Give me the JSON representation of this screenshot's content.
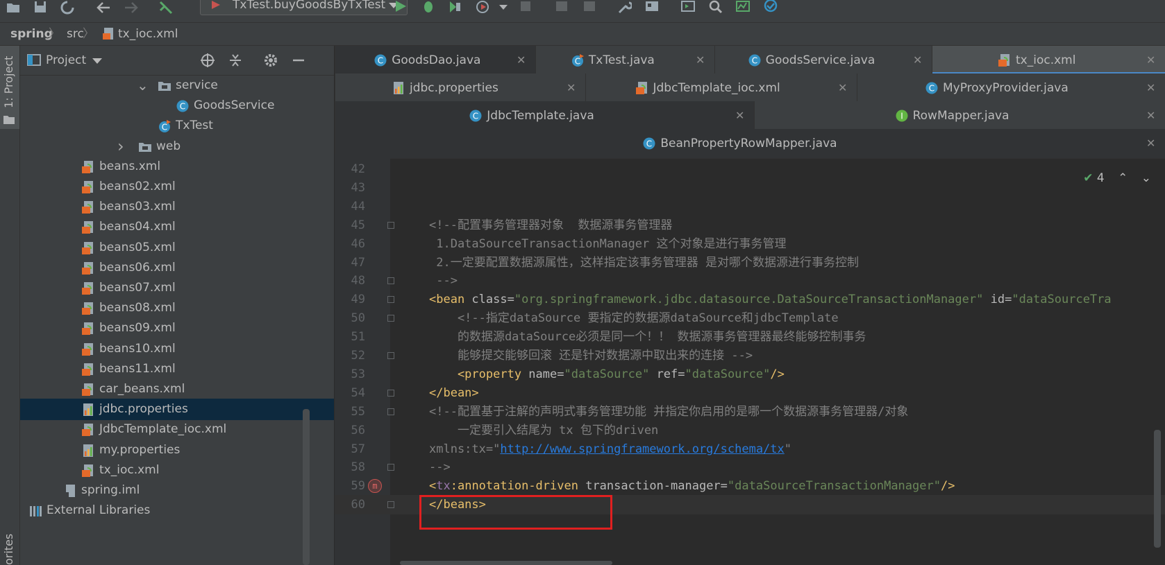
{
  "toolbar": {
    "run_config": "TxTest.buyGoodsByTxTest",
    "icons": [
      "open-icon",
      "save-icon",
      "sync-icon",
      "back-icon",
      "forward-icon",
      "build-icon",
      "run-icon",
      "debug-icon",
      "coverage-icon",
      "profile-icon",
      "stop-icon",
      "attach-icon",
      "layout-icon",
      "settings-icon",
      "structure-icon",
      "terminal-icon",
      "search-icon",
      "metrics-icon",
      "check-icon"
    ]
  },
  "navbar": {
    "crumbs": [
      "spring",
      "src",
      "tx_ioc.xml"
    ]
  },
  "stripe": {
    "project_label": "1: Project",
    "favorites_label": "orites"
  },
  "project_panel": {
    "title": "Project",
    "tree": [
      {
        "label": "service",
        "type": "folder",
        "depth": 3,
        "expanded": true
      },
      {
        "label": "GoodsService",
        "type": "class",
        "depth": 4
      },
      {
        "label": "TxTest",
        "type": "class-test",
        "depth": 3
      },
      {
        "label": "web",
        "type": "folder",
        "depth": 2,
        "expanded": false
      },
      {
        "label": "beans.xml",
        "type": "xml",
        "depth": 1
      },
      {
        "label": "beans02.xml",
        "type": "xml",
        "depth": 1
      },
      {
        "label": "beans03.xml",
        "type": "xml",
        "depth": 1
      },
      {
        "label": "beans04.xml",
        "type": "xml",
        "depth": 1
      },
      {
        "label": "beans05.xml",
        "type": "xml",
        "depth": 1
      },
      {
        "label": "beans06.xml",
        "type": "xml",
        "depth": 1
      },
      {
        "label": "beans07.xml",
        "type": "xml",
        "depth": 1
      },
      {
        "label": "beans08.xml",
        "type": "xml",
        "depth": 1
      },
      {
        "label": "beans09.xml",
        "type": "xml",
        "depth": 1
      },
      {
        "label": "beans10.xml",
        "type": "xml",
        "depth": 1
      },
      {
        "label": "beans11.xml",
        "type": "xml",
        "depth": 1
      },
      {
        "label": "car_beans.xml",
        "type": "xml",
        "depth": 1
      },
      {
        "label": "jdbc.properties",
        "type": "properties",
        "depth": 1,
        "selected": true
      },
      {
        "label": "JdbcTemplate_ioc.xml",
        "type": "xml",
        "depth": 1
      },
      {
        "label": "my.properties",
        "type": "properties",
        "depth": 1
      },
      {
        "label": "tx_ioc.xml",
        "type": "xml",
        "depth": 1
      },
      {
        "label": "spring.iml",
        "type": "iml",
        "depth": 0
      },
      {
        "label": "External Libraries",
        "type": "libs",
        "depth": -1,
        "expanded": false
      }
    ]
  },
  "tabs": {
    "row1": [
      {
        "label": "GoodsDao.java",
        "icon": "class-icon"
      },
      {
        "label": "TxTest.java",
        "icon": "test-class-icon"
      },
      {
        "label": "GoodsService.java",
        "icon": "class-icon"
      },
      {
        "label": "tx_ioc.xml",
        "icon": "xml-icon",
        "active": true
      }
    ],
    "row2": [
      {
        "label": "jdbc.properties",
        "icon": "properties-icon"
      },
      {
        "label": "JdbcTemplate_ioc.xml",
        "icon": "xml-icon"
      },
      {
        "label": "MyProxyProvider.java",
        "icon": "class-icon"
      }
    ],
    "row3": [
      {
        "label": "JdbcTemplate.java",
        "icon": "class-icon"
      },
      {
        "label": "RowMapper.java",
        "icon": "interface-icon"
      }
    ],
    "row4": [
      {
        "label": "BeanPropertyRowMapper.java",
        "icon": "class-icon"
      }
    ],
    "close_glyph": "✕"
  },
  "editor": {
    "inspection_count": "4",
    "lines": [
      {
        "n": "42",
        "segments": []
      },
      {
        "n": "43",
        "segments": []
      },
      {
        "n": "44",
        "segments": []
      },
      {
        "n": "45",
        "segments": [
          {
            "t": "<!--配置事务管理器对象  数据源事务管理器",
            "c": "c-comment"
          }
        ]
      },
      {
        "n": "46",
        "segments": [
          {
            "t": " 1.DataSourceTransactionManager 这个对象是进行事务管理",
            "c": "c-comment"
          }
        ]
      },
      {
        "n": "47",
        "segments": [
          {
            "t": " 2.一定要配置数据源属性，这样指定该事务管理器 是对哪个数据源进行事务控制",
            "c": "c-comment"
          }
        ]
      },
      {
        "n": "48",
        "segments": [
          {
            "t": " -->",
            "c": "c-comment"
          }
        ]
      },
      {
        "n": "49",
        "segments": [
          {
            "t": "<bean ",
            "c": "c-tag"
          },
          {
            "t": "class",
            "c": "c-attr"
          },
          {
            "t": "=",
            "c": "c-attr"
          },
          {
            "t": "\"org.springframework.jdbc.datasource.DataSourceTransactionManager\"",
            "c": "c-val"
          },
          {
            "t": " id",
            "c": "c-attr"
          },
          {
            "t": "=",
            "c": "c-attr"
          },
          {
            "t": "\"dataSourceTra",
            "c": "c-val"
          }
        ]
      },
      {
        "n": "50",
        "segments": [
          {
            "t": "    <!--指定dataSource 要指定的数据源dataSource和jdbcTemplate",
            "c": "c-comment"
          }
        ]
      },
      {
        "n": "51",
        "segments": [
          {
            "t": "    的数据源dataSource必须是同一个！！ 数据源事务管理器最终能够控制事务",
            "c": "c-comment"
          }
        ]
      },
      {
        "n": "52",
        "segments": [
          {
            "t": "    能够提交能够回滚 还是针对数据源中取出来的连接 -->",
            "c": "c-comment"
          }
        ]
      },
      {
        "n": "53",
        "segments": [
          {
            "t": "    <property ",
            "c": "c-tag"
          },
          {
            "t": "name",
            "c": "c-attr"
          },
          {
            "t": "=",
            "c": "c-attr"
          },
          {
            "t": "\"dataSource\"",
            "c": "c-val"
          },
          {
            "t": " ref",
            "c": "c-attr"
          },
          {
            "t": "=",
            "c": "c-attr"
          },
          {
            "t": "\"dataSource\"",
            "c": "c-val"
          },
          {
            "t": "/>",
            "c": "c-tag"
          }
        ]
      },
      {
        "n": "54",
        "segments": [
          {
            "t": "</bean>",
            "c": "c-tag"
          }
        ]
      },
      {
        "n": "55",
        "segments": [
          {
            "t": "<!--配置基于注解的声明式事务管理功能 并指定你启用的是哪一个数据源事务管理器/对象",
            "c": "c-comment"
          }
        ]
      },
      {
        "n": "56",
        "segments": [
          {
            "t": "    一定要引入结尾为 tx 包下的driven",
            "c": "c-comment"
          }
        ]
      },
      {
        "n": "57",
        "segments": [
          {
            "t": "xmlns:tx=\"",
            "c": "c-comment"
          },
          {
            "t": "http://www.springframework.org/schema/tx",
            "c": "c-url"
          },
          {
            "t": "\"",
            "c": "c-comment"
          }
        ]
      },
      {
        "n": "58",
        "segments": [
          {
            "t": "-->",
            "c": "c-comment"
          }
        ]
      },
      {
        "n": "59",
        "segments": [
          {
            "t": "<",
            "c": "c-tag"
          },
          {
            "t": "tx",
            "c": "c-ns"
          },
          {
            "t": ":annotation-driven ",
            "c": "c-tag"
          },
          {
            "t": "transaction-manager",
            "c": "c-attr"
          },
          {
            "t": "=",
            "c": "c-attr"
          },
          {
            "t": "\"dataSourceTransactionManager\"",
            "c": "c-val"
          },
          {
            "t": "/>",
            "c": "c-tag"
          }
        ]
      },
      {
        "n": "60",
        "segments": [
          {
            "t": "</beans>",
            "c": "c-tag"
          }
        ],
        "current": true
      }
    ]
  }
}
